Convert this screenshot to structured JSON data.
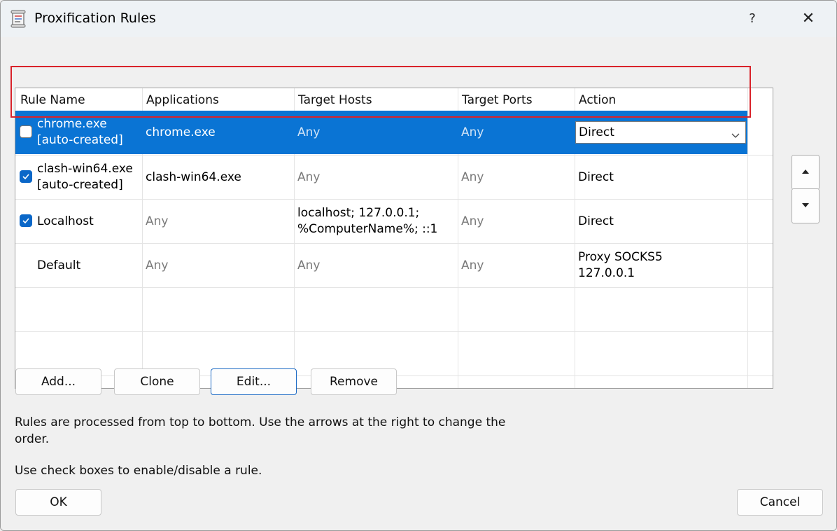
{
  "window": {
    "title": "Proxification Rules",
    "help_label": "?",
    "close_label": "✕"
  },
  "table": {
    "columns": [
      "Rule Name",
      "Applications",
      "Target Hosts",
      "Target Ports",
      "Action"
    ],
    "rows": [
      {
        "checked": false,
        "name": [
          "chrome.exe",
          "[auto-created]"
        ],
        "applications": "chrome.exe",
        "target_hosts": [
          "Any"
        ],
        "target_ports": "Any",
        "action": [
          "Direct"
        ],
        "selected": true
      },
      {
        "checked": true,
        "name": [
          "clash-win64.exe",
          "[auto-created]"
        ],
        "applications": "clash-win64.exe",
        "target_hosts": [
          "Any"
        ],
        "target_ports": "Any",
        "action": [
          "Direct"
        ],
        "selected": false
      },
      {
        "checked": true,
        "name": [
          "Localhost"
        ],
        "applications": "Any",
        "target_hosts": [
          "localhost; 127.0.0.1;",
          "%ComputerName%; ::1"
        ],
        "target_ports": "Any",
        "action": [
          "Direct"
        ],
        "selected": false
      },
      {
        "checked": null,
        "name": [
          "Default"
        ],
        "applications": "Any",
        "target_hosts": [
          "Any"
        ],
        "target_ports": "Any",
        "action": [
          "Proxy SOCKS5",
          "127.0.0.1"
        ],
        "selected": false
      }
    ]
  },
  "buttons": {
    "add": "Add...",
    "clone": "Clone",
    "edit": "Edit...",
    "remove": "Remove",
    "ok": "OK",
    "cancel": "Cancel"
  },
  "info": {
    "line1": "Rules are processed from top to bottom. Use the arrows at the right to change the",
    "line2": "order.",
    "line3": "Use check boxes to enable/disable a rule."
  },
  "colors": {
    "selection": "#0a74d4",
    "checkbox_on": "#0a67c8",
    "highlight_border": "#d9222a"
  }
}
